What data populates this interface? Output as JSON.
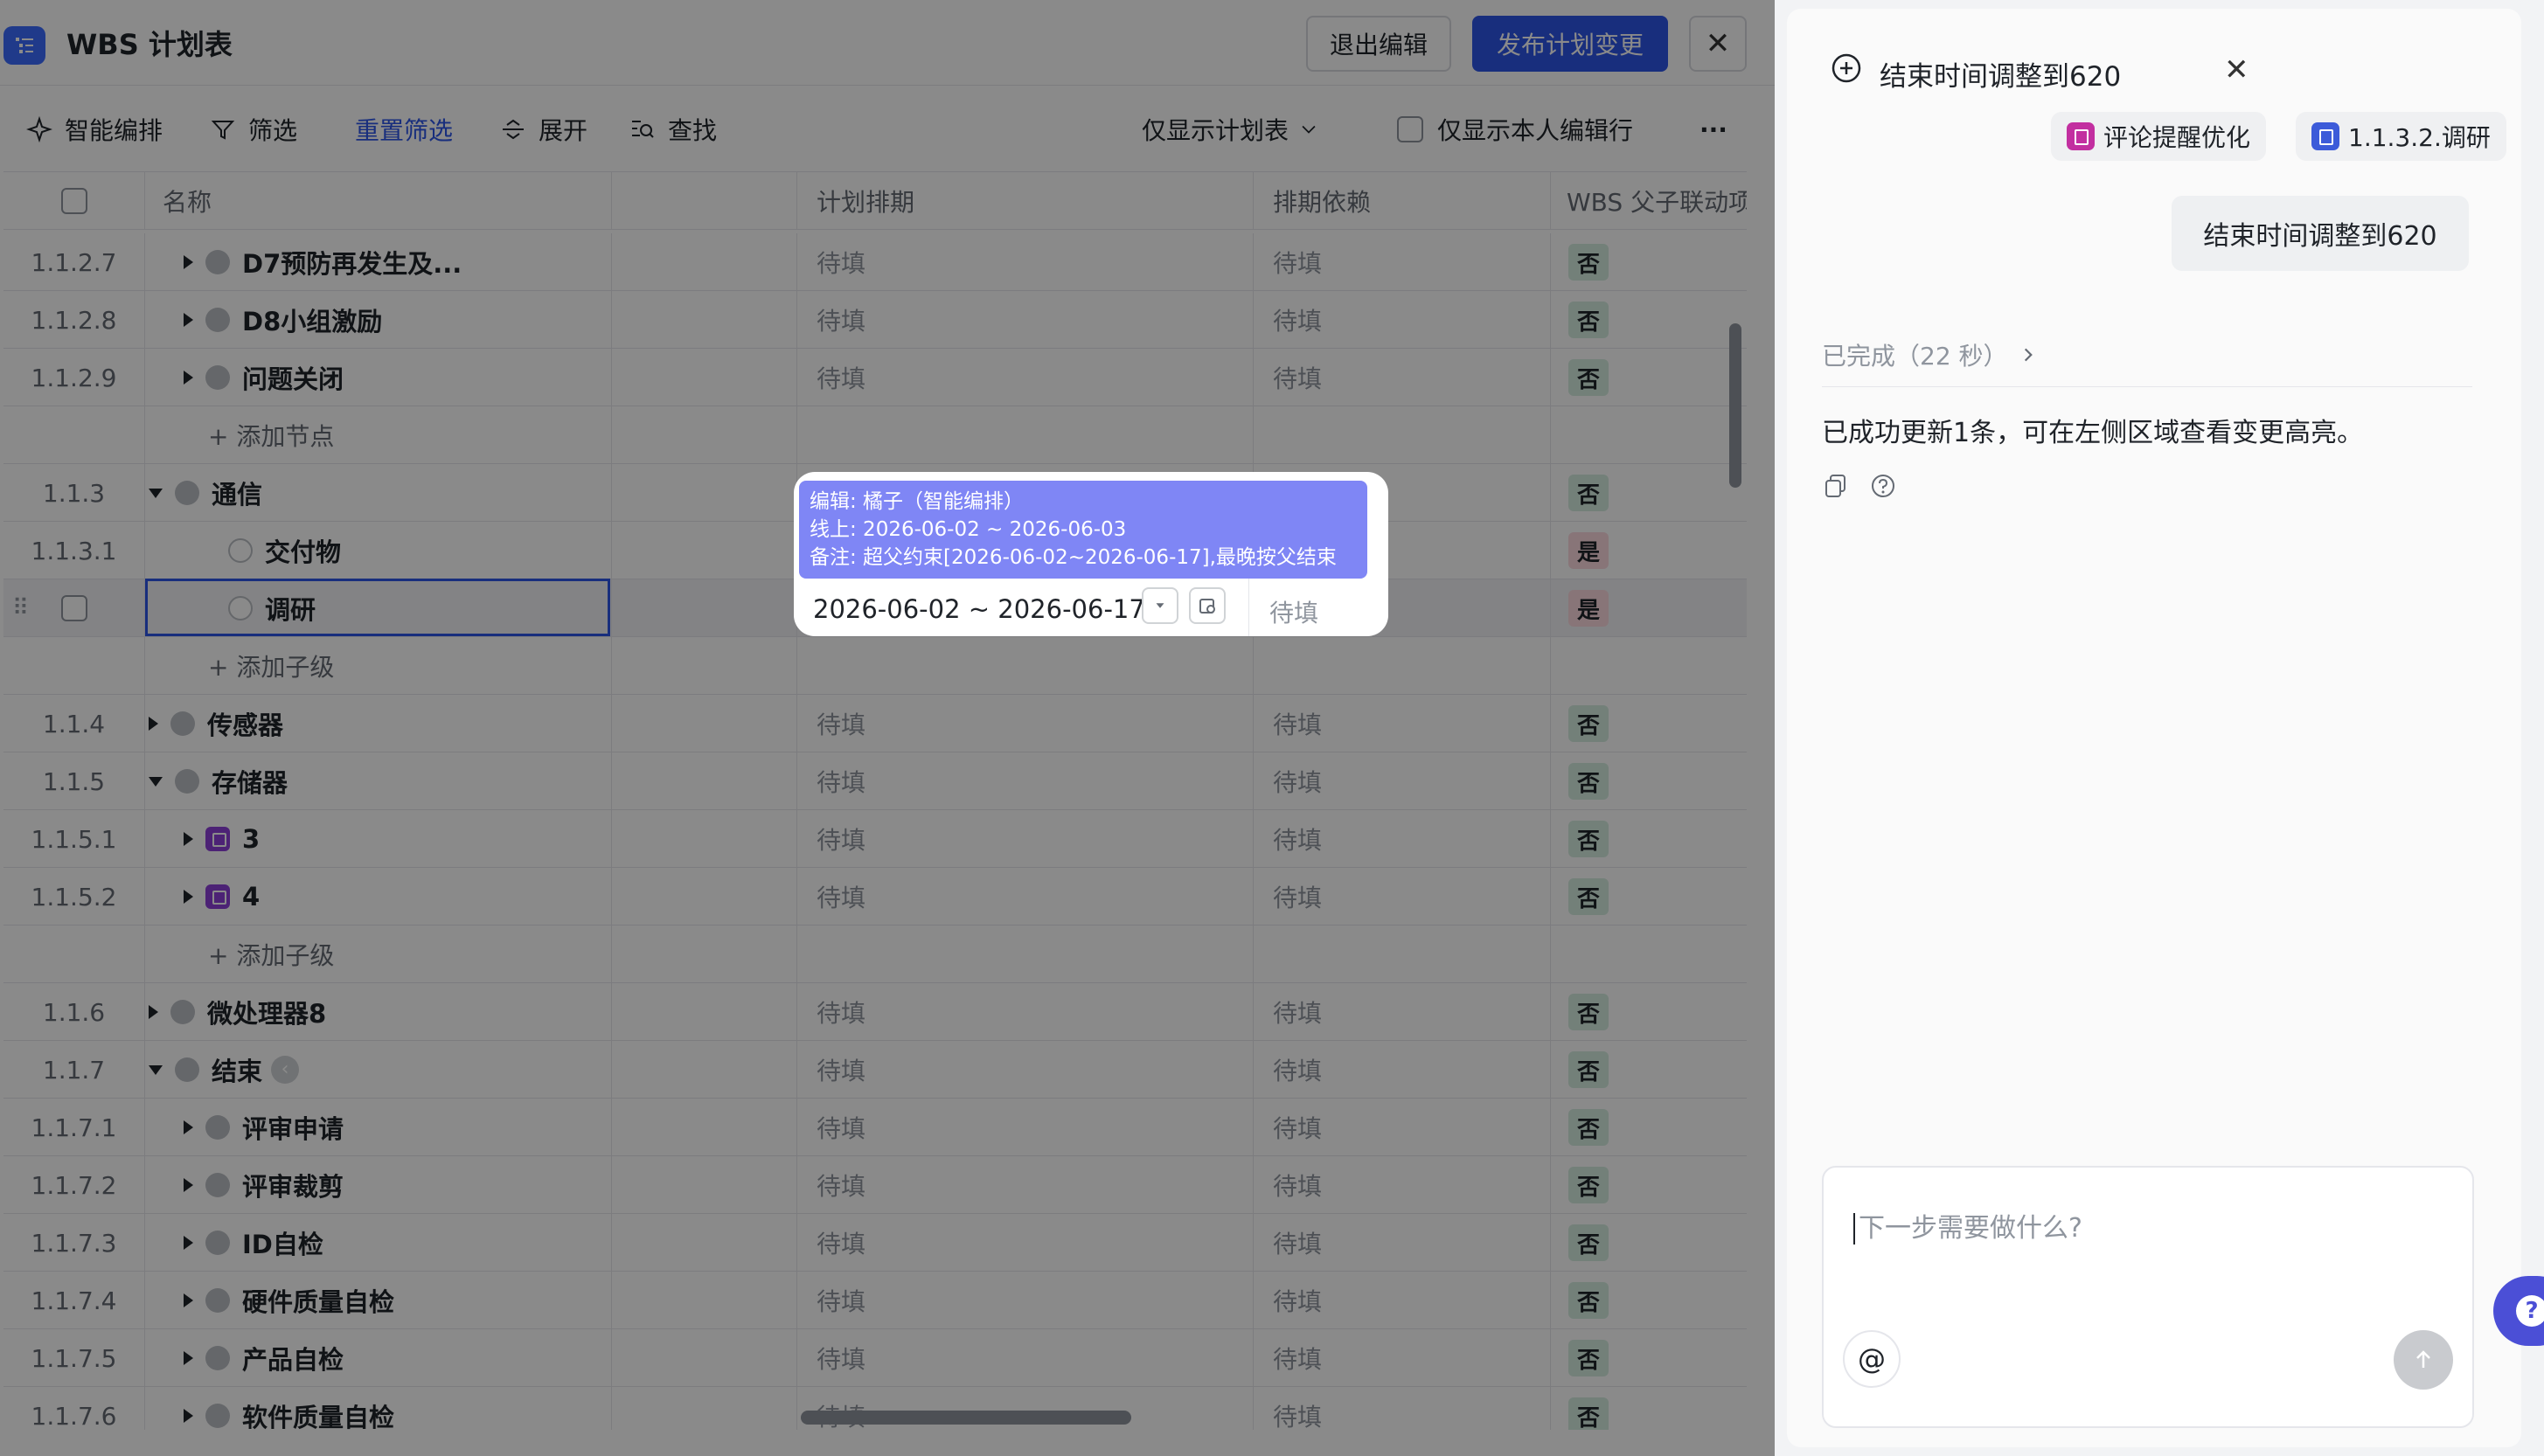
{
  "header": {
    "title": "WBS 计划表",
    "exit_label": "退出编辑",
    "publish_label": "发布计划变更",
    "close_label": "✕"
  },
  "toolbar": {
    "smart_schedule": "智能编排",
    "filter": "筛选",
    "reset_filter": "重置筛选",
    "expand": "展开",
    "find": "查找",
    "view_select": "仅显示计划表",
    "only_mine": "仅显示本人编辑行",
    "more": "···"
  },
  "table": {
    "headers": {
      "name": "名称",
      "schedule": "计划排期",
      "dependency": "排期依赖",
      "wbs_link": "WBS 父子联动项"
    },
    "rows": [
      {
        "num": "1.1.2.7",
        "name": "D7预防再发生及...",
        "schedule": "待填",
        "dependency": "待填",
        "wbs": "否"
      },
      {
        "num": "1.1.2.8",
        "name": "D8小组激励",
        "schedule": "待填",
        "dependency": "待填",
        "wbs": "否"
      },
      {
        "num": "1.1.2.9",
        "name": "问题关闭",
        "schedule": "待填",
        "dependency": "待填",
        "wbs": "否"
      },
      {
        "add": "添加节点"
      },
      {
        "num": "1.1.3",
        "name": "通信",
        "schedule": "",
        "dependency": "",
        "wbs": "否"
      },
      {
        "num": "1.1.3.1",
        "name": "交付物",
        "schedule": "",
        "dependency": "",
        "wbs": "是"
      },
      {
        "num": "",
        "name": "调研",
        "schedule": "",
        "dependency": "待填",
        "wbs": "是"
      },
      {
        "add": "添加子级"
      },
      {
        "num": "1.1.4",
        "name": "传感器",
        "schedule": "待填",
        "dependency": "待填",
        "wbs": "否"
      },
      {
        "num": "1.1.5",
        "name": "存储器",
        "schedule": "待填",
        "dependency": "待填",
        "wbs": "否"
      },
      {
        "num": "1.1.5.1",
        "name": "3",
        "schedule": "待填",
        "dependency": "待填",
        "wbs": "否"
      },
      {
        "num": "1.1.5.2",
        "name": "4",
        "schedule": "待填",
        "dependency": "待填",
        "wbs": "否"
      },
      {
        "add": "添加子级"
      },
      {
        "num": "1.1.6",
        "name": "微处理器8",
        "schedule": "待填",
        "dependency": "待填",
        "wbs": "否"
      },
      {
        "num": "1.1.7",
        "name": "结束",
        "schedule": "待填",
        "dependency": "待填",
        "wbs": "否"
      },
      {
        "num": "1.1.7.1",
        "name": "评审申请",
        "schedule": "待填",
        "dependency": "待填",
        "wbs": "否"
      },
      {
        "num": "1.1.7.2",
        "name": "评审裁剪",
        "schedule": "待填",
        "dependency": "待填",
        "wbs": "否"
      },
      {
        "num": "1.1.7.3",
        "name": "ID自检",
        "schedule": "待填",
        "dependency": "待填",
        "wbs": "否"
      },
      {
        "num": "1.1.7.4",
        "name": "硬件质量自检",
        "schedule": "待填",
        "dependency": "待填",
        "wbs": "否"
      },
      {
        "num": "1.1.7.5",
        "name": "产品自检",
        "schedule": "待填",
        "dependency": "待填",
        "wbs": "否"
      },
      {
        "num": "1.1.7.6",
        "name": "软件质量自检",
        "schedule": "待填",
        "dependency": "待填",
        "wbs": "否"
      }
    ]
  },
  "popup": {
    "tip_line1": "编辑: 橘子（智能编排）",
    "tip_line2": "线上: 2026-06-02 ~ 2026-06-03",
    "tip_line3": "备注: 超父约束[2026-06-02~2026-06-17],最晚按父结束",
    "date_value": "2026-06-02 ~ 2026-06-17",
    "dependency": "待填"
  },
  "chat": {
    "title": "结束时间调整到620",
    "chip1": "评论提醒优化",
    "chip2": "1.1.3.2.调研",
    "user_message": "结束时间调整到620",
    "status": "已完成（22 秒）",
    "result": "已成功更新1条，可在左侧区域查看变更高亮。",
    "input_placeholder": "下一步需要做什么?",
    "at_label": "@"
  },
  "colors": {
    "primary": "#2d55e8",
    "tip_bg": "#7f86f5",
    "badge_no": "#d4ecdf",
    "badge_yes": "#fbd9de",
    "purple_icon": "#8c3fd9"
  }
}
